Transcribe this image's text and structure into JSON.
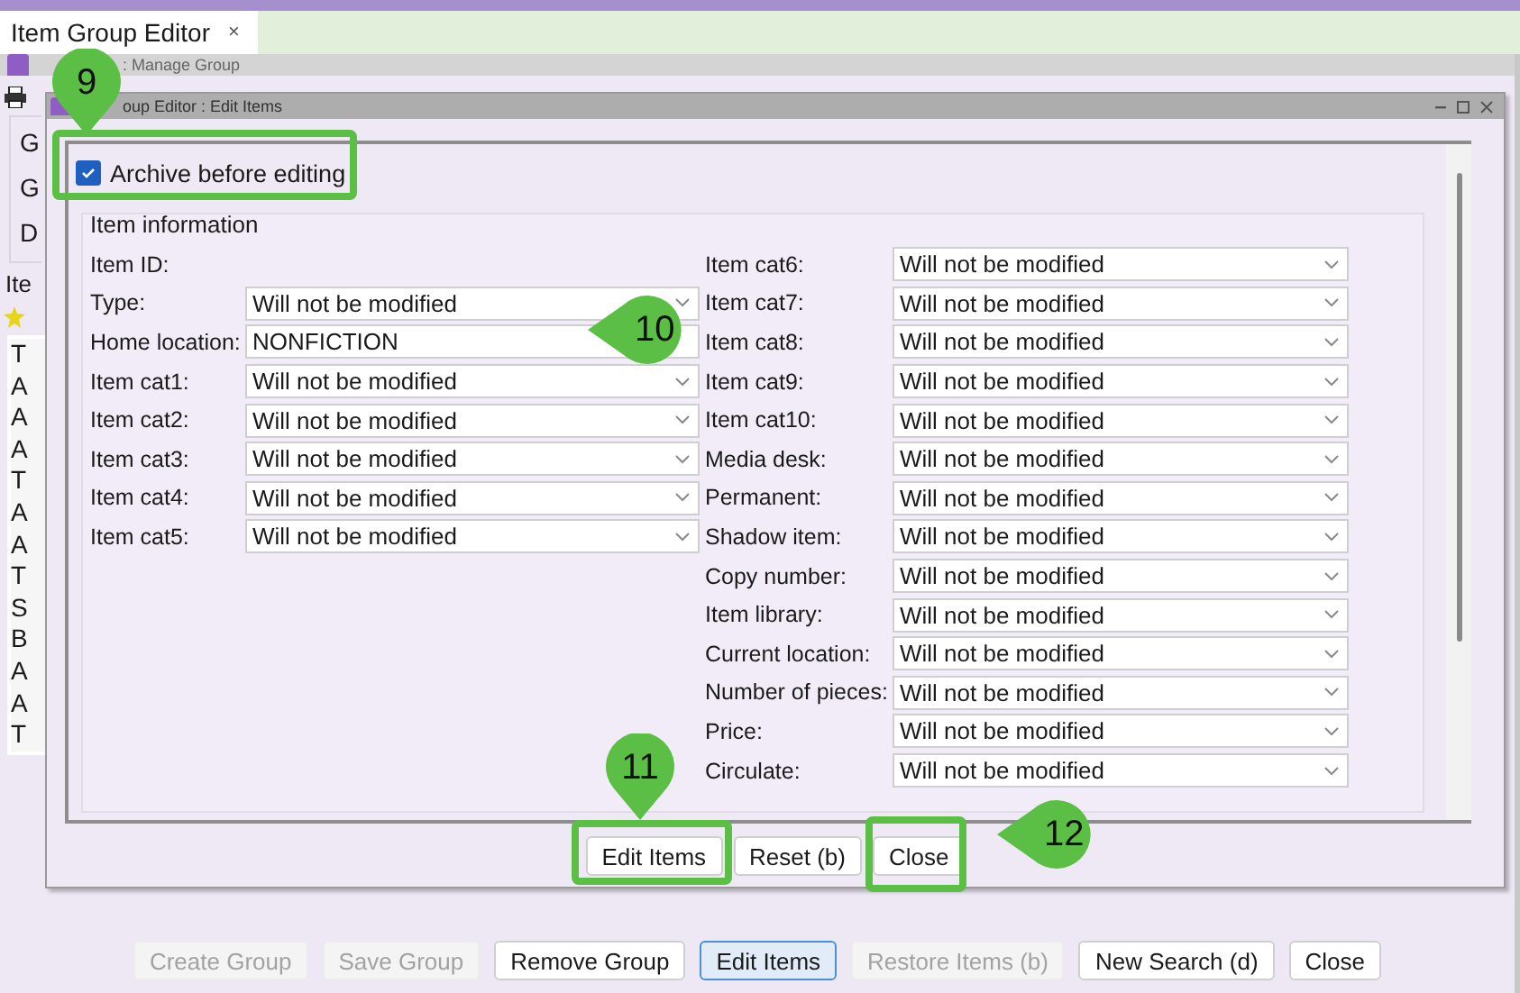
{
  "tab": {
    "label": "Item Group Editor",
    "close": "×",
    "selected": true
  },
  "back_window": {
    "title": ": Manage Group",
    "group_letters": [
      "G",
      "G",
      "D"
    ],
    "list_heading": "Ite",
    "list_letters": [
      "T",
      "A",
      "A",
      "A",
      "T",
      "A",
      "A",
      "T",
      "S",
      "B",
      "A",
      "A",
      "T"
    ],
    "buttons": [
      {
        "label": "Create Group",
        "disabled": true,
        "selected": false
      },
      {
        "label": "Save Group",
        "disabled": true,
        "selected": false
      },
      {
        "label": "Remove Group",
        "disabled": false,
        "selected": false
      },
      {
        "label": "Edit Items",
        "disabled": false,
        "selected": true
      },
      {
        "label": "Restore Items (b)",
        "disabled": true,
        "selected": false
      },
      {
        "label": "New Search (d)",
        "disabled": false,
        "selected": false
      },
      {
        "label": "Close",
        "disabled": false,
        "selected": false
      }
    ]
  },
  "dialog": {
    "title": "oup Editor : Edit Items",
    "archive": {
      "label": "Archive before editing",
      "checked": true
    },
    "section": "Item information",
    "left_fields": [
      {
        "label": "Item ID:",
        "kind": "none"
      },
      {
        "label": "Type:",
        "kind": "dropdown",
        "value": "Will not be modified"
      },
      {
        "label": "Home location:",
        "kind": "text",
        "value": "NONFICTION"
      },
      {
        "label": "Item cat1:",
        "kind": "dropdown",
        "value": "Will not be modified"
      },
      {
        "label": "Item cat2:",
        "kind": "dropdown",
        "value": "Will not be modified"
      },
      {
        "label": "Item cat3:",
        "kind": "dropdown",
        "value": "Will not be modified"
      },
      {
        "label": "Item cat4:",
        "kind": "dropdown",
        "value": "Will not be modified"
      },
      {
        "label": "Item cat5:",
        "kind": "dropdown",
        "value": "Will not be modified"
      }
    ],
    "right_fields": [
      {
        "label": "Item cat6:",
        "kind": "dropdown",
        "value": "Will not be modified"
      },
      {
        "label": "Item cat7:",
        "kind": "dropdown",
        "value": "Will not be modified"
      },
      {
        "label": "Item cat8:",
        "kind": "dropdown",
        "value": "Will not be modified"
      },
      {
        "label": "Item cat9:",
        "kind": "dropdown",
        "value": "Will not be modified"
      },
      {
        "label": "Item cat10:",
        "kind": "dropdown",
        "value": "Will not be modified"
      },
      {
        "label": "Media desk:",
        "kind": "dropdown",
        "value": "Will not be modified"
      },
      {
        "label": "Permanent:",
        "kind": "dropdown",
        "value": "Will not be modified"
      },
      {
        "label": "Shadow item:",
        "kind": "dropdown",
        "value": "Will not be modified"
      },
      {
        "label": "Copy number:",
        "kind": "dropdown",
        "value": "Will not be modified"
      },
      {
        "label": "Item library:",
        "kind": "dropdown",
        "value": "Will not be modified"
      },
      {
        "label": "Current location:",
        "kind": "dropdown",
        "value": "Will not be modified"
      },
      {
        "label": "Number of pieces:",
        "kind": "dropdown",
        "value": "Will not be modified"
      },
      {
        "label": "Price:",
        "kind": "dropdown",
        "value": "Will not be modified"
      },
      {
        "label": "Circulate:",
        "kind": "dropdown",
        "value": "Will not be modified"
      }
    ],
    "buttons": [
      "Edit Items",
      "Reset (b)",
      "Close"
    ]
  },
  "callouts": [
    {
      "number": "9",
      "kind": "down"
    },
    {
      "number": "10",
      "kind": "left"
    },
    {
      "number": "11",
      "kind": "down"
    },
    {
      "number": "12",
      "kind": "left"
    }
  ]
}
